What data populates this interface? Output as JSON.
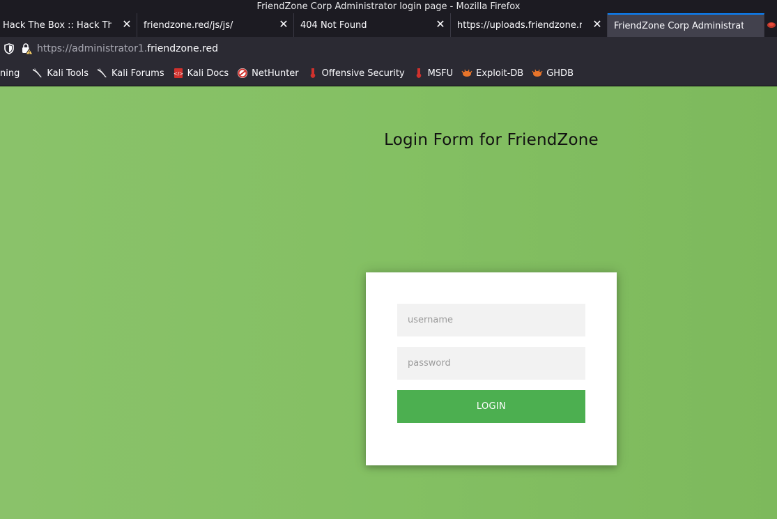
{
  "window": {
    "title": "FriendZone Corp Administrator login page - Mozilla Firefox"
  },
  "tabs": [
    {
      "label": "Hack The Box :: Hack The Box",
      "selected": false
    },
    {
      "label": "friendzone.red/js/js/",
      "selected": false
    },
    {
      "label": "404 Not Found",
      "selected": false
    },
    {
      "label": "https://uploads.friendzone.red/",
      "selected": false
    },
    {
      "label": "FriendZone Corp Administrator login page",
      "selected": true
    }
  ],
  "navbar": {
    "url_prefix": "https://administrator1.",
    "url_domain": "friendzone.red"
  },
  "bookmarks": [
    {
      "label": "ning",
      "icon": "none"
    },
    {
      "label": "Kali Tools",
      "icon": "kali-dragon-icon"
    },
    {
      "label": "Kali Forums",
      "icon": "kali-dragon-icon"
    },
    {
      "label": "Kali Docs",
      "icon": "kali-docs-icon"
    },
    {
      "label": "NetHunter",
      "icon": "nethunter-icon"
    },
    {
      "label": "Offensive Security",
      "icon": "offsec-icon"
    },
    {
      "label": "MSFU",
      "icon": "offsec-icon"
    },
    {
      "label": "Exploit-DB",
      "icon": "exploitdb-icon"
    },
    {
      "label": "GHDB",
      "icon": "exploitdb-icon"
    }
  ],
  "page": {
    "heading": "Login Form for FriendZone",
    "form": {
      "username_placeholder": "username",
      "password_placeholder": "password",
      "login_label": "LOGIN"
    }
  },
  "colors": {
    "accent": "#0a84ff",
    "page_background": "#84c063",
    "login_button": "#4caf50"
  }
}
